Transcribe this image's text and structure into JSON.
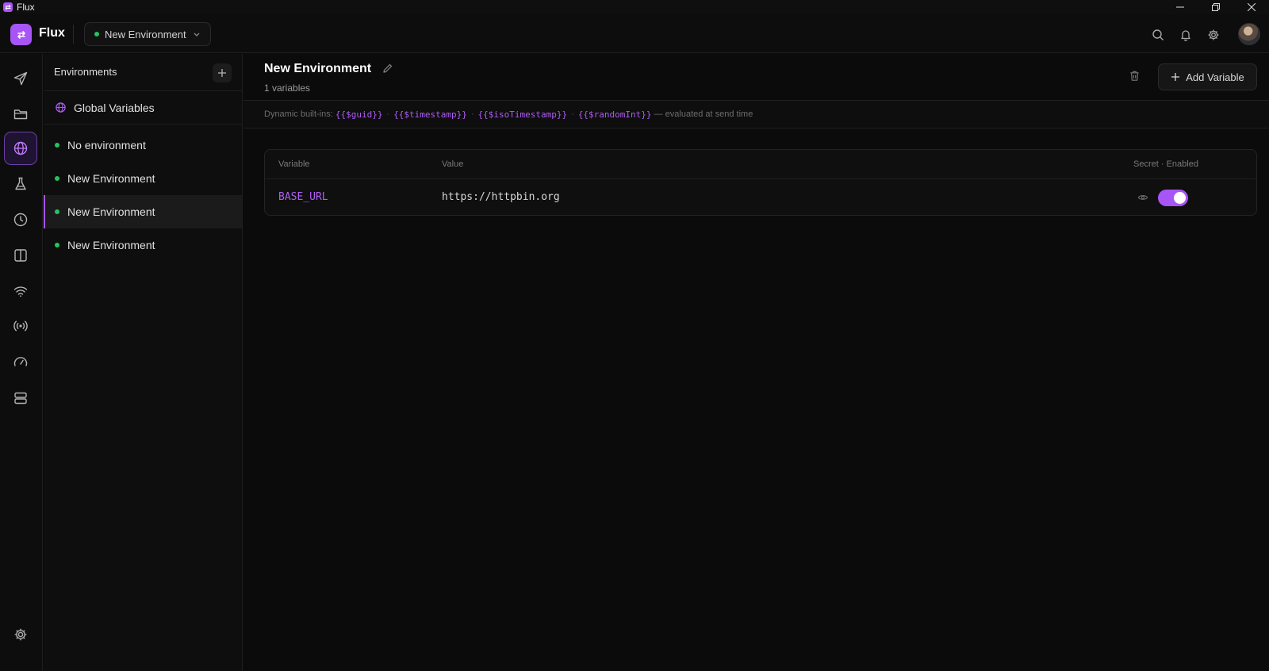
{
  "window": {
    "title": "Flux"
  },
  "header": {
    "brand": "Flux",
    "active_environment": "New Environment",
    "icons": [
      "search-icon",
      "bell-icon",
      "gear-icon"
    ]
  },
  "rail": {
    "items": [
      "send-icon",
      "folder-icon",
      "globe-icon",
      "flask-icon",
      "history-icon",
      "split-view-icon",
      "wifi-icon",
      "broadcast-icon",
      "gauge-icon",
      "server-icon"
    ],
    "active": "globe-icon",
    "bottom": "gear-icon"
  },
  "env_panel": {
    "title": "Environments",
    "global_label": "Global Variables",
    "items": [
      {
        "label": "No environment",
        "status_color": "#22c55e"
      },
      {
        "label": "New Environment",
        "status_color": "#22c55e"
      },
      {
        "label": "New Environment",
        "status_color": "#22c55e",
        "selected": true
      },
      {
        "label": "New Environment",
        "status_color": "#22c55e"
      }
    ]
  },
  "main": {
    "title": "New Environment",
    "count_label": "1 variables",
    "add_button": "Add Variable",
    "builtins": {
      "prefix": "Dynamic built-ins:",
      "tokens": [
        "{{$guid}}",
        "{{$timestamp}}",
        "{{$isoTimestamp}}",
        "{{$randomInt}}"
      ],
      "suffix": "— evaluated at send time"
    },
    "table": {
      "headers": {
        "variable": "Variable",
        "value": "Value",
        "flags": "Secret · Enabled"
      },
      "rows": [
        {
          "name": "BASE_URL",
          "value": "https://httpbin.org",
          "secret": false,
          "enabled": true
        }
      ]
    }
  },
  "colors": {
    "accent": "#a855f7",
    "status_ok": "#22c55e",
    "background": "#0b0b0b"
  }
}
